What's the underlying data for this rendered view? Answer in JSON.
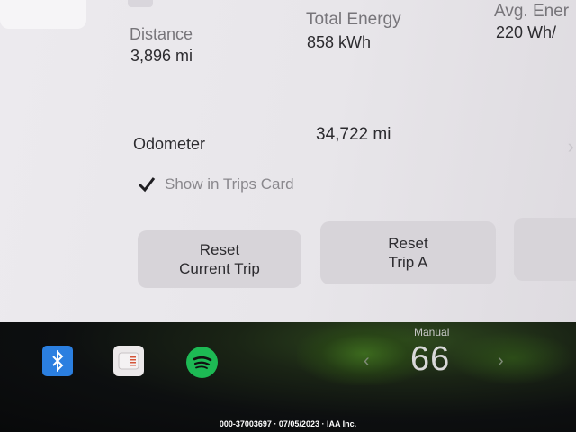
{
  "trip_stats": {
    "distance_label": "Distance",
    "distance_value": "3,896 mi",
    "energy_label": "Total Energy",
    "energy_value": "858 kWh",
    "avg_label": "Avg. Ener",
    "avg_value": "220 Wh/"
  },
  "odometer": {
    "label": "Odometer",
    "value": "34,722 mi"
  },
  "show_in_trips": {
    "label": "Show in Trips Card",
    "checked": true
  },
  "buttons": {
    "reset_current_line1": "Reset",
    "reset_current_line2": "Current Trip",
    "reset_a_line1": "Reset",
    "reset_a_line2": "Trip A"
  },
  "dock": {
    "icons": [
      "bluetooth-icon",
      "radio-icon",
      "spotify-icon"
    ],
    "climate_mode": "Manual",
    "climate_temp": "66"
  },
  "caption": "000-37003697 · 07/05/2023 · IAA Inc.",
  "colors": {
    "bluetooth": "#2b7fe0",
    "spotify": "#1db954"
  }
}
